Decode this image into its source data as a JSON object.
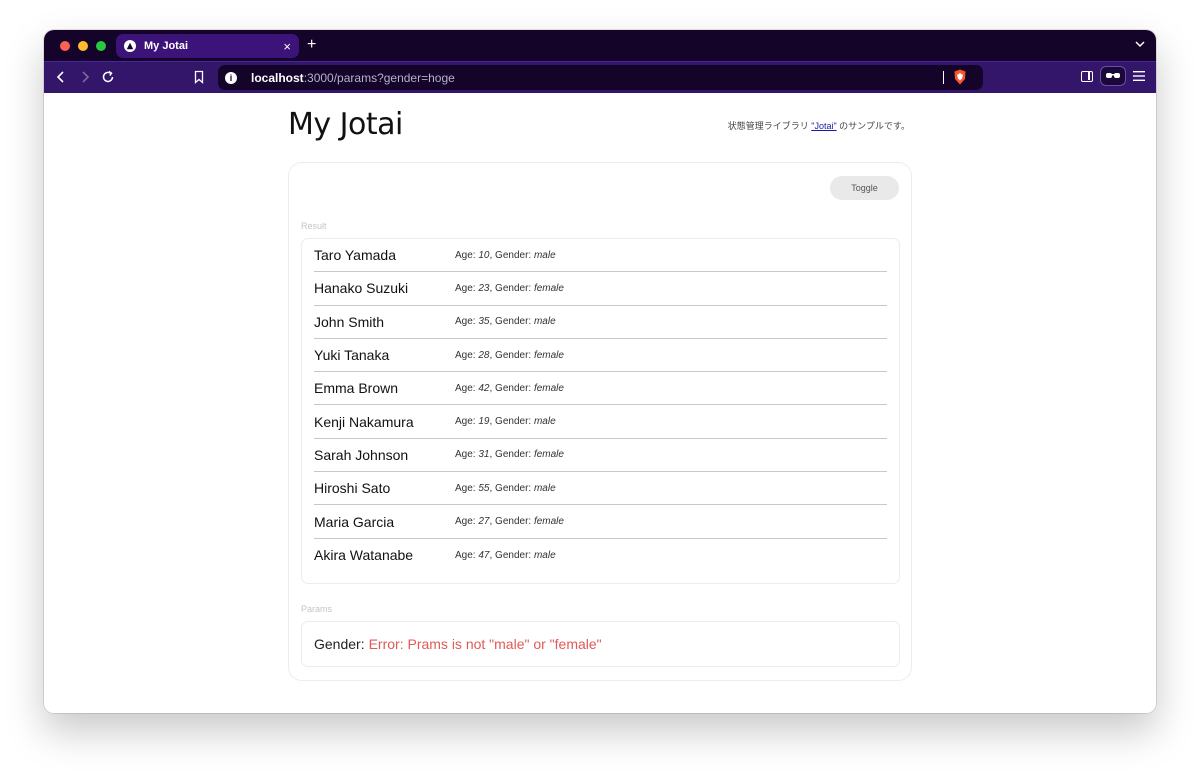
{
  "browser": {
    "tab_title": "My Jotai",
    "tab_close": "×",
    "new_tab": "+",
    "url_host": "localhost",
    "url_rest": ":3000/params?gender=hoge",
    "info_icon": "i"
  },
  "page": {
    "title": "My Jotai",
    "subtitle_before": "状態管理ライブラリ ",
    "subtitle_link": "\"Jotai\"",
    "subtitle_after": " のサンプルです。",
    "toggle_label": "Toggle",
    "result_label": "Result",
    "params_label": "Params"
  },
  "age_label": "Age: ",
  "gender_label": ", Gender: ",
  "people": [
    {
      "name": "Taro Yamada",
      "age": "10",
      "gender": "male"
    },
    {
      "name": "Hanako Suzuki",
      "age": "23",
      "gender": "female"
    },
    {
      "name": "John Smith",
      "age": "35",
      "gender": "male"
    },
    {
      "name": "Yuki Tanaka",
      "age": "28",
      "gender": "female"
    },
    {
      "name": "Emma Brown",
      "age": "42",
      "gender": "female"
    },
    {
      "name": "Kenji Nakamura",
      "age": "19",
      "gender": "male"
    },
    {
      "name": "Sarah Johnson",
      "age": "31",
      "gender": "female"
    },
    {
      "name": "Hiroshi Sato",
      "age": "55",
      "gender": "male"
    },
    {
      "name": "Maria Garcia",
      "age": "27",
      "gender": "female"
    },
    {
      "name": "Akira Watanabe",
      "age": "47",
      "gender": "male"
    }
  ],
  "params": {
    "gender_label": "Gender:",
    "error": "Error: Prams is not \"male\" or \"female\""
  },
  "colors": {
    "tabstrip": "#14042a",
    "toolbar": "#33156a",
    "active_tab": "#3c1378",
    "error": "#e05a57",
    "link": "#1a1aa6"
  },
  "icons": [
    "close-icon",
    "plus-icon",
    "chevron-down-icon",
    "back-icon",
    "forward-icon",
    "reload-icon",
    "bookmark-icon",
    "info-icon",
    "brave-shield-icon",
    "sidebar-icon",
    "wallet-icon",
    "menu-icon"
  ]
}
